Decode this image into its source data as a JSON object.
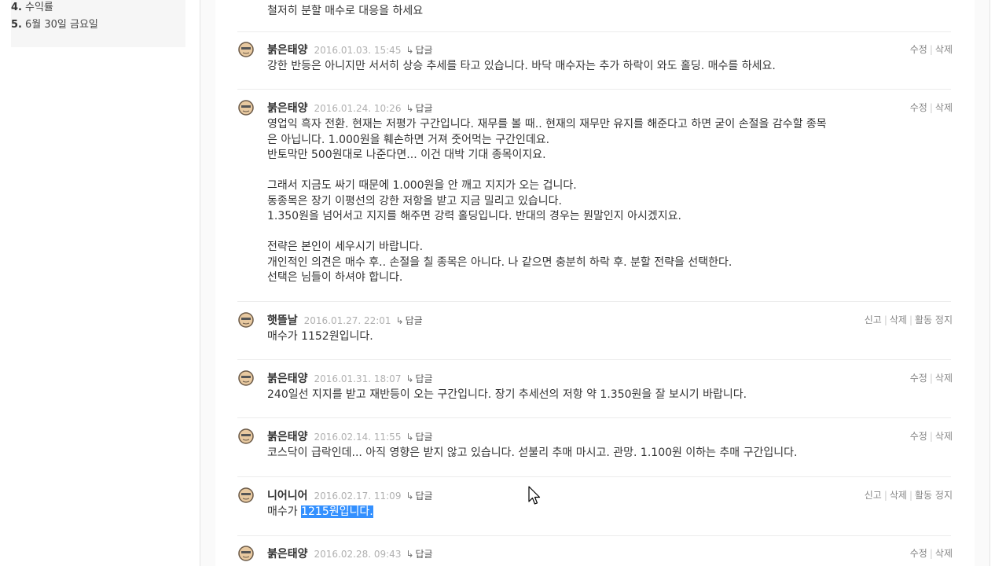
{
  "sidebar": {
    "items": [
      {
        "num": "4.",
        "label": "수익률"
      },
      {
        "num": "5.",
        "label": "6월 30일 금요일"
      }
    ]
  },
  "top_text": "철저히 분할 매수로 대응을 하세요",
  "reply_label": "답글",
  "comments": [
    {
      "author": "붉은태양",
      "date": "2016.01.03. 15:45",
      "actions": [
        "수정",
        "삭제"
      ],
      "lines": [
        "강한 반등은 아니지만 서서히 상승 추세를 타고 있습니다. 바닥 매수자는 추가 하락이 와도 홀딩. 매수를 하세요."
      ]
    },
    {
      "author": "붉은태양",
      "date": "2016.01.24. 10:26",
      "actions": [
        "수정",
        "삭제"
      ],
      "lines": [
        "영업익 흑자 전환. 현재는 저평가 구간입니다. 재무를 볼 때.. 현재의 재무만 유지를 해준다고 하면 굳이 손절을 감수할 종목",
        "은 아닙니다. 1.000원을 훼손하면 거져 줏어먹는 구간인데요.",
        "반토막만 500원대로 나준다면... 이건 대박 기대 종목이지요.",
        "",
        "그래서 지금도 싸기 때문에 1.000원을 안 깨고 지지가 오는 겁니다.",
        "동종목은 장기 이평선의 강한 저항을 받고 지금 밀리고 있습니다.",
        "1.350원을 넘어서고 지지를 해주면 강력 홀딩입니다. 반대의 경우는 뭔말인지 아시겠지요.",
        "",
        "전략은 본인이 세우시기 바랍니다.",
        "개인적인 의견은 매수 후.. 손절을 칠 종목은 아니다. 나 같으면 충분히 하락 후. 분할 전략을 선택한다.",
        "선택은 님들이 하셔야 합니다."
      ]
    },
    {
      "author": "햇뜰날",
      "date": "2016.01.27. 22:01",
      "actions": [
        "신고",
        "삭제",
        "활동 정지"
      ],
      "lines": [
        "매수가 1152원입니다."
      ]
    },
    {
      "author": "붉은태양",
      "date": "2016.01.31. 18:07",
      "actions": [
        "수정",
        "삭제"
      ],
      "lines": [
        "240일선 지지를 받고 재반등이 오는 구간입니다. 장기 추세선의 저항 약 1.350원을 잘 보시기 바랍니다."
      ]
    },
    {
      "author": "붉은태양",
      "date": "2016.02.14. 11:55",
      "actions": [
        "수정",
        "삭제"
      ],
      "lines": [
        "코스닥이 급락인데... 아직 영향은 받지 않고 있습니다. 섣불리 추매 마시고. 관망. 1.100원 이하는 추매 구간입니다."
      ]
    },
    {
      "author": "니어니어",
      "date": "2016.02.17. 11:09",
      "actions": [
        "신고",
        "삭제",
        "활동 정지"
      ],
      "line_plain": "매수가 ",
      "line_selected": "1215원입니다."
    },
    {
      "author": "붉은태양",
      "date": "2016.02.28. 09:43",
      "actions": [
        "수정",
        "삭제"
      ],
      "lines": []
    }
  ]
}
